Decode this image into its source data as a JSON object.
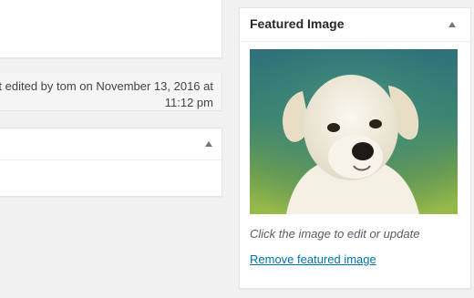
{
  "edit_info": {
    "text": "t edited by tom on November 13, 2016 at 11:12 pm"
  },
  "featured_image": {
    "title": "Featured Image",
    "hint": "Click the image to edit or update",
    "remove_link": "Remove featured image"
  },
  "colors": {
    "link": "#0073aa",
    "background": "#f1f1f1",
    "panel": "#ffffff"
  },
  "icons": [
    "collapse-arrow-icon"
  ]
}
